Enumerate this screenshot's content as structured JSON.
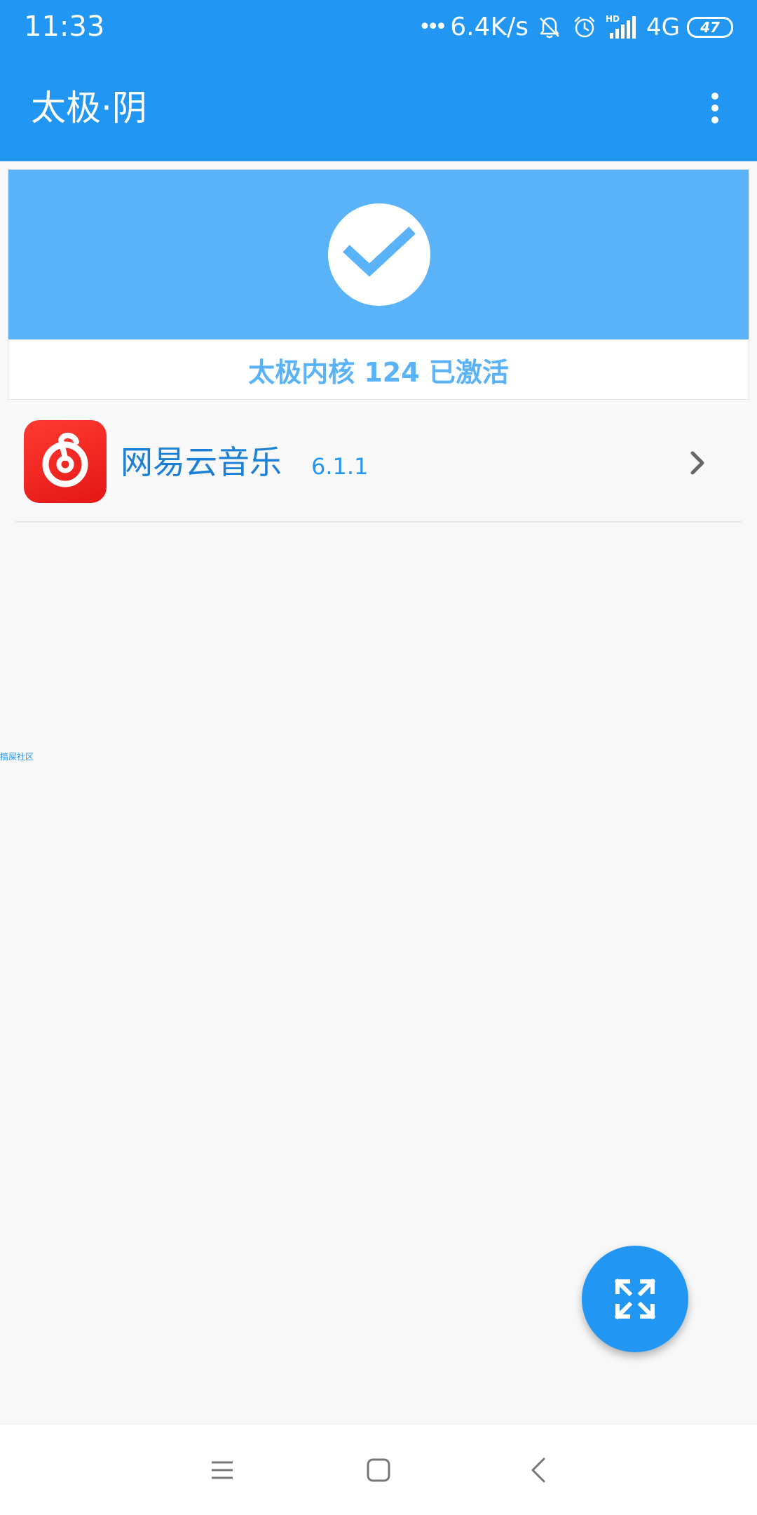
{
  "status_bar": {
    "time": "11:33",
    "dots": "•••",
    "net_speed": "6.4K/s",
    "network": "4G",
    "hd_label": "HD",
    "battery": "47",
    "icons": [
      "mute-bell-icon",
      "alarm-icon",
      "signal-icon",
      "battery-icon"
    ]
  },
  "app_bar": {
    "title": "太极·阴",
    "menu_icon": "overflow-menu-icon"
  },
  "status_card": {
    "icon": "check-icon",
    "text": "太极内核 124 已激活",
    "colors": {
      "card_bg": "#5ab2f8",
      "text": "#5ab2f8"
    }
  },
  "apps": [
    {
      "name": "网易云音乐",
      "version": "6.1.1",
      "icon": "netease-music-icon"
    }
  ],
  "side_watermark": "搞屎社区",
  "fab": {
    "icon": "expand-icon"
  },
  "nav_bar": {
    "icons": [
      "menu-icon",
      "home-icon",
      "back-icon"
    ]
  },
  "colors": {
    "primary": "#2196f3",
    "app_red": "#ee1c1c",
    "background": "#f8f8f8"
  }
}
